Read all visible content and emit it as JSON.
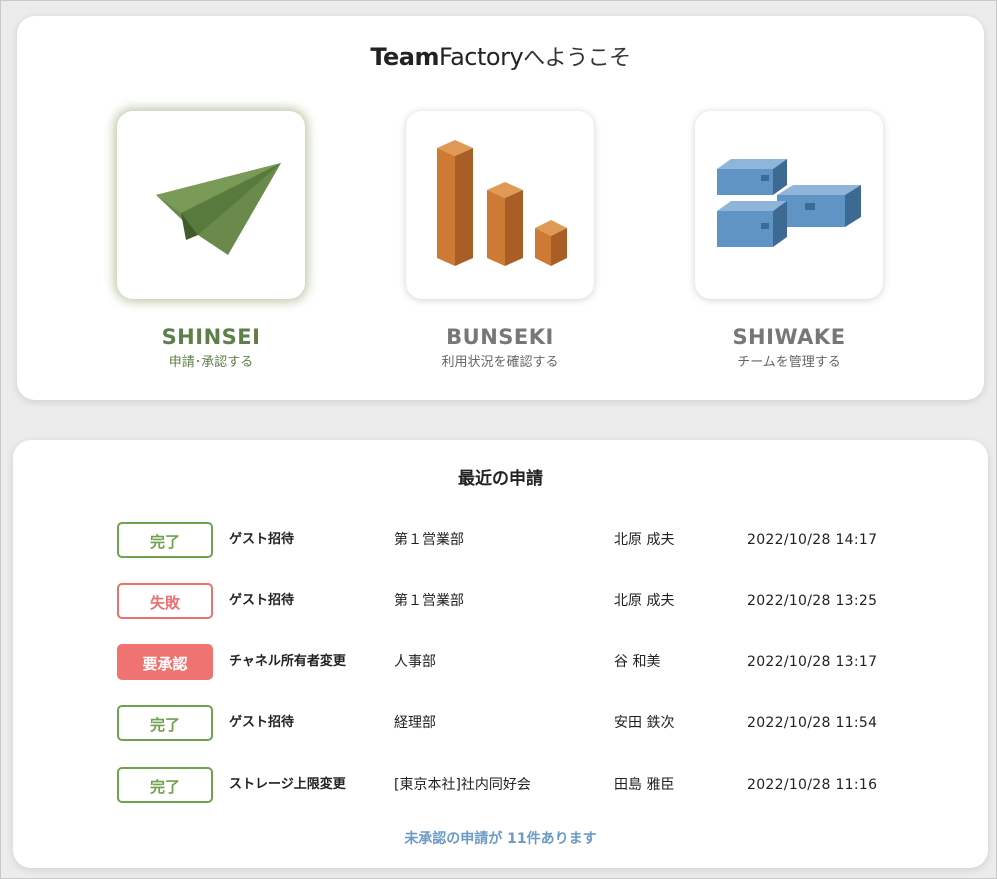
{
  "welcome": {
    "title_bold": "Team",
    "title_light": "Factory",
    "title_suffix": "へようこそ"
  },
  "apps": [
    {
      "name": "SHINSEI",
      "desc": "申請･承認する",
      "icon": "paper-plane-icon",
      "color": "#5e7f4a"
    },
    {
      "name": "BUNSEKI",
      "desc": "利用状況を確認する",
      "icon": "bar-blocks-icon",
      "color": "#c97a35"
    },
    {
      "name": "SHIWAKE",
      "desc": "チームを管理する",
      "icon": "drawer-blocks-icon",
      "color": "#5f94c4"
    }
  ],
  "recent": {
    "title": "最近の申請",
    "rows": [
      {
        "status": "完了",
        "status_kind": "done",
        "type": "ゲスト招待",
        "dept": "第１営業部",
        "person": "北原 成夫",
        "time": "2022/10/28 14:17"
      },
      {
        "status": "失敗",
        "status_kind": "fail",
        "type": "ゲスト招待",
        "dept": "第１営業部",
        "person": "北原 成夫",
        "time": "2022/10/28 13:25"
      },
      {
        "status": "要承認",
        "status_kind": "pending",
        "type": "チャネル所有者変更",
        "dept": "人事部",
        "person": "谷 和美",
        "time": "2022/10/28 13:17"
      },
      {
        "status": "完了",
        "status_kind": "done",
        "type": "ゲスト招待",
        "dept": "経理部",
        "person": "安田 鉄次",
        "time": "2022/10/28 11:54"
      },
      {
        "status": "完了",
        "status_kind": "done",
        "type": "ストレージ上限変更",
        "dept": "[東京本社]社内同好会",
        "person": "田島 雅臣",
        "time": "2022/10/28 11:16"
      }
    ],
    "pending_notice": "未承認の申請が 11件あります"
  },
  "colors": {
    "done": "#6fa24f",
    "fail": "#e9716f",
    "pending": "#ef7370",
    "link": "#6b9ac4"
  }
}
